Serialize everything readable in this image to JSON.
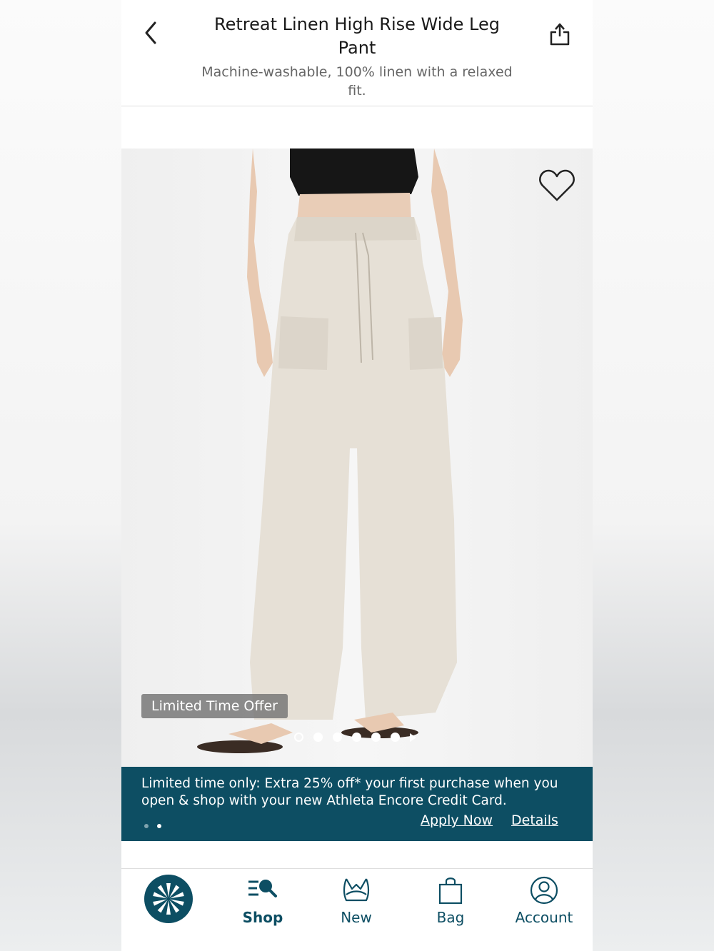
{
  "header": {
    "title": "Retreat Linen High Rise Wide Leg Pant",
    "subtitle": "Machine-washable, 100% linen with a relaxed fit.",
    "back_icon": "chevron-left-icon",
    "share_icon": "share-icon"
  },
  "product_image": {
    "favorite_icon": "heart-icon",
    "offer_tag": "Limited Time Offer",
    "carousel": {
      "total_dots": 6,
      "active_index": 0,
      "has_next_arrow": true
    }
  },
  "promo": {
    "text": "Limited time only: Extra 25% off* your first purchase when you open & shop with your new Athleta Encore Credit Card.",
    "apply_label": "Apply Now",
    "details_label": "Details",
    "pager": {
      "total": 2,
      "active_index": 1
    },
    "background": "#0d4e63"
  },
  "nav": {
    "items": [
      {
        "label": "",
        "icon": "athleta-logo-icon"
      },
      {
        "label": "Shop",
        "icon": "shop-search-icon"
      },
      {
        "label": "New",
        "icon": "new-bra-icon"
      },
      {
        "label": "Bag",
        "icon": "bag-icon"
      },
      {
        "label": "Account",
        "icon": "account-icon"
      }
    ],
    "accent": "#0d4e63"
  }
}
